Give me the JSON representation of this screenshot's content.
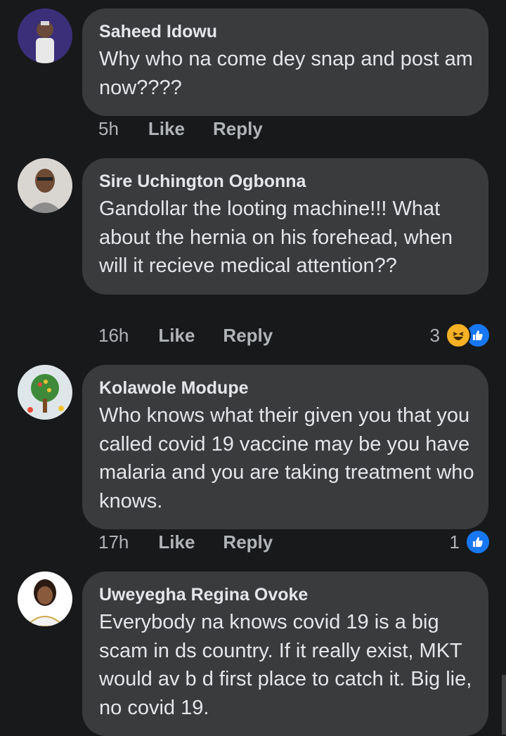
{
  "comments": [
    {
      "name": "Saheed Idowu",
      "text": "Why who na come dey snap and post am now????",
      "time": "5h",
      "like_label": "Like",
      "reply_label": "Reply",
      "reaction_count": "",
      "reaction_icons": []
    },
    {
      "name": "Sire Uchington Ogbonna",
      "text": "Gandollar the looting machine!!! What about the hernia on his forehead, when will it recieve medical attention??",
      "time": "16h",
      "like_label": "Like",
      "reply_label": "Reply",
      "reaction_count": "3",
      "reaction_icons": [
        "haha-icon",
        "like-icon"
      ]
    },
    {
      "name": "Kolawole Modupe",
      "text": "Who knows what their given you that you called covid 19 vaccine may be you have malaria and you are taking treatment who knows.",
      "time": "17h",
      "like_label": "Like",
      "reply_label": "Reply",
      "reaction_count": "1",
      "reaction_icons": [
        "like-icon"
      ]
    },
    {
      "name": "Uweyegha Regina Ovoke",
      "text": "Everybody na knows covid 19 is a big scam in ds country. If it really exist, MKT would av b d first place to catch it. Big lie, no covid 19.",
      "time": "",
      "like_label": "",
      "reply_label": "",
      "reaction_count": "",
      "reaction_icons": []
    }
  ],
  "colors": {
    "background": "#18191a",
    "bubble": "#3a3b3c",
    "text_primary": "#e4e6eb",
    "text_secondary": "#b0b3b8",
    "like_blue": "#1877f2",
    "haha_yellow": "#f7b125"
  }
}
